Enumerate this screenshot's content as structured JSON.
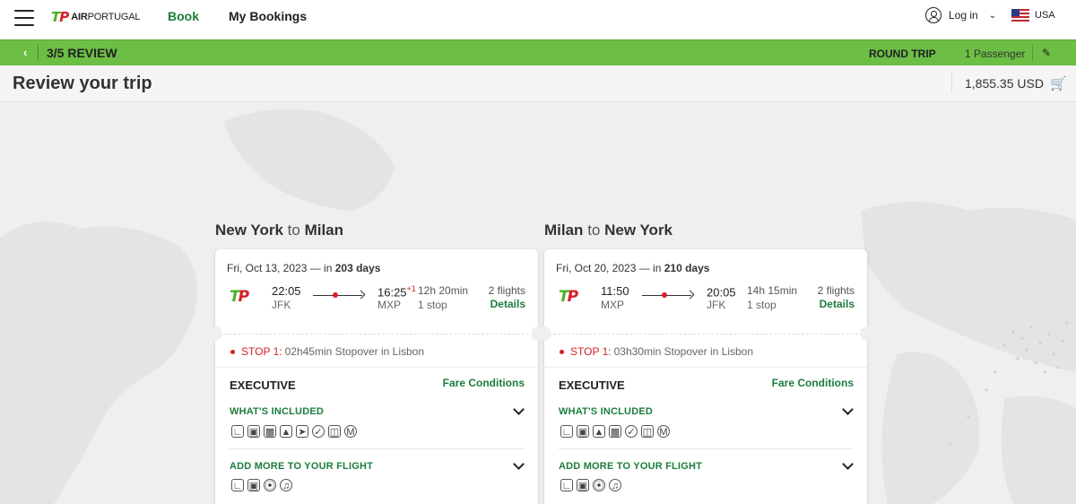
{
  "header": {
    "logo_mark_t": "T",
    "logo_mark_p": "P",
    "logo_text_bold": "AIR",
    "logo_text_light": "PORTUGAL",
    "nav_book": "Book",
    "nav_bookings": "My Bookings",
    "login": "Log in",
    "country": "USA"
  },
  "stepbar": {
    "step": "3/5 REVIEW",
    "trip_type": "ROUND TRIP",
    "passengers": "1 Passenger"
  },
  "review": {
    "title": "Review your trip",
    "total_price": "1,855.35 USD"
  },
  "trips": [
    {
      "origin": "New York",
      "to": "to",
      "destination": "Milan",
      "date": "Fri, Oct 13, 2023",
      "in_text": "— in",
      "days": "203 days",
      "dep_time": "22:05",
      "dep_code": "JFK",
      "arr_time": "16:25",
      "day_offset": "+1",
      "arr_code": "MXP",
      "duration": "12h 20min",
      "stops": "1 stop",
      "flights": "2 flights",
      "details": "Details",
      "stop_label": "STOP 1:",
      "stop_text": "02h45min Stopover in Lisbon",
      "cabin": "EXECUTIVE",
      "fare_conditions": "Fare Conditions",
      "whats_included": "WHAT'S INCLUDED",
      "add_more": "ADD MORE TO YOUR FLIGHT",
      "included_icons": [
        "seat-icon",
        "bag-icon",
        "lounge-icon",
        "priority-icon",
        "fast-track-icon",
        "miles-icon",
        "train-icon",
        "meal-icon"
      ],
      "addon_icons": [
        "seat-icon",
        "bag-icon",
        "bike-icon",
        "instrument-icon"
      ]
    },
    {
      "origin": "Milan",
      "to": "to",
      "destination": "New York",
      "date": "Fri, Oct 20, 2023",
      "in_text": "— in",
      "days": "210 days",
      "dep_time": "11:50",
      "dep_code": "MXP",
      "arr_time": "20:05",
      "day_offset": "",
      "arr_code": "JFK",
      "duration": "14h 15min",
      "stops": "1 stop",
      "flights": "2 flights",
      "details": "Details",
      "stop_label": "STOP 1:",
      "stop_text": "03h30min Stopover in Lisbon",
      "cabin": "EXECUTIVE",
      "fare_conditions": "Fare Conditions",
      "whats_included": "WHAT'S INCLUDED",
      "add_more": "ADD MORE TO YOUR FLIGHT",
      "included_icons": [
        "seat-icon",
        "bag-icon",
        "priority-icon",
        "lounge-icon",
        "miles-icon",
        "train-icon",
        "meal-icon"
      ],
      "addon_icons": [
        "seat-icon",
        "bag-icon",
        "bike-icon",
        "instrument-icon"
      ]
    }
  ],
  "colors": {
    "brand_green": "#6cbe45",
    "link_green": "#1b7d3d",
    "brand_red": "#d81e27"
  }
}
